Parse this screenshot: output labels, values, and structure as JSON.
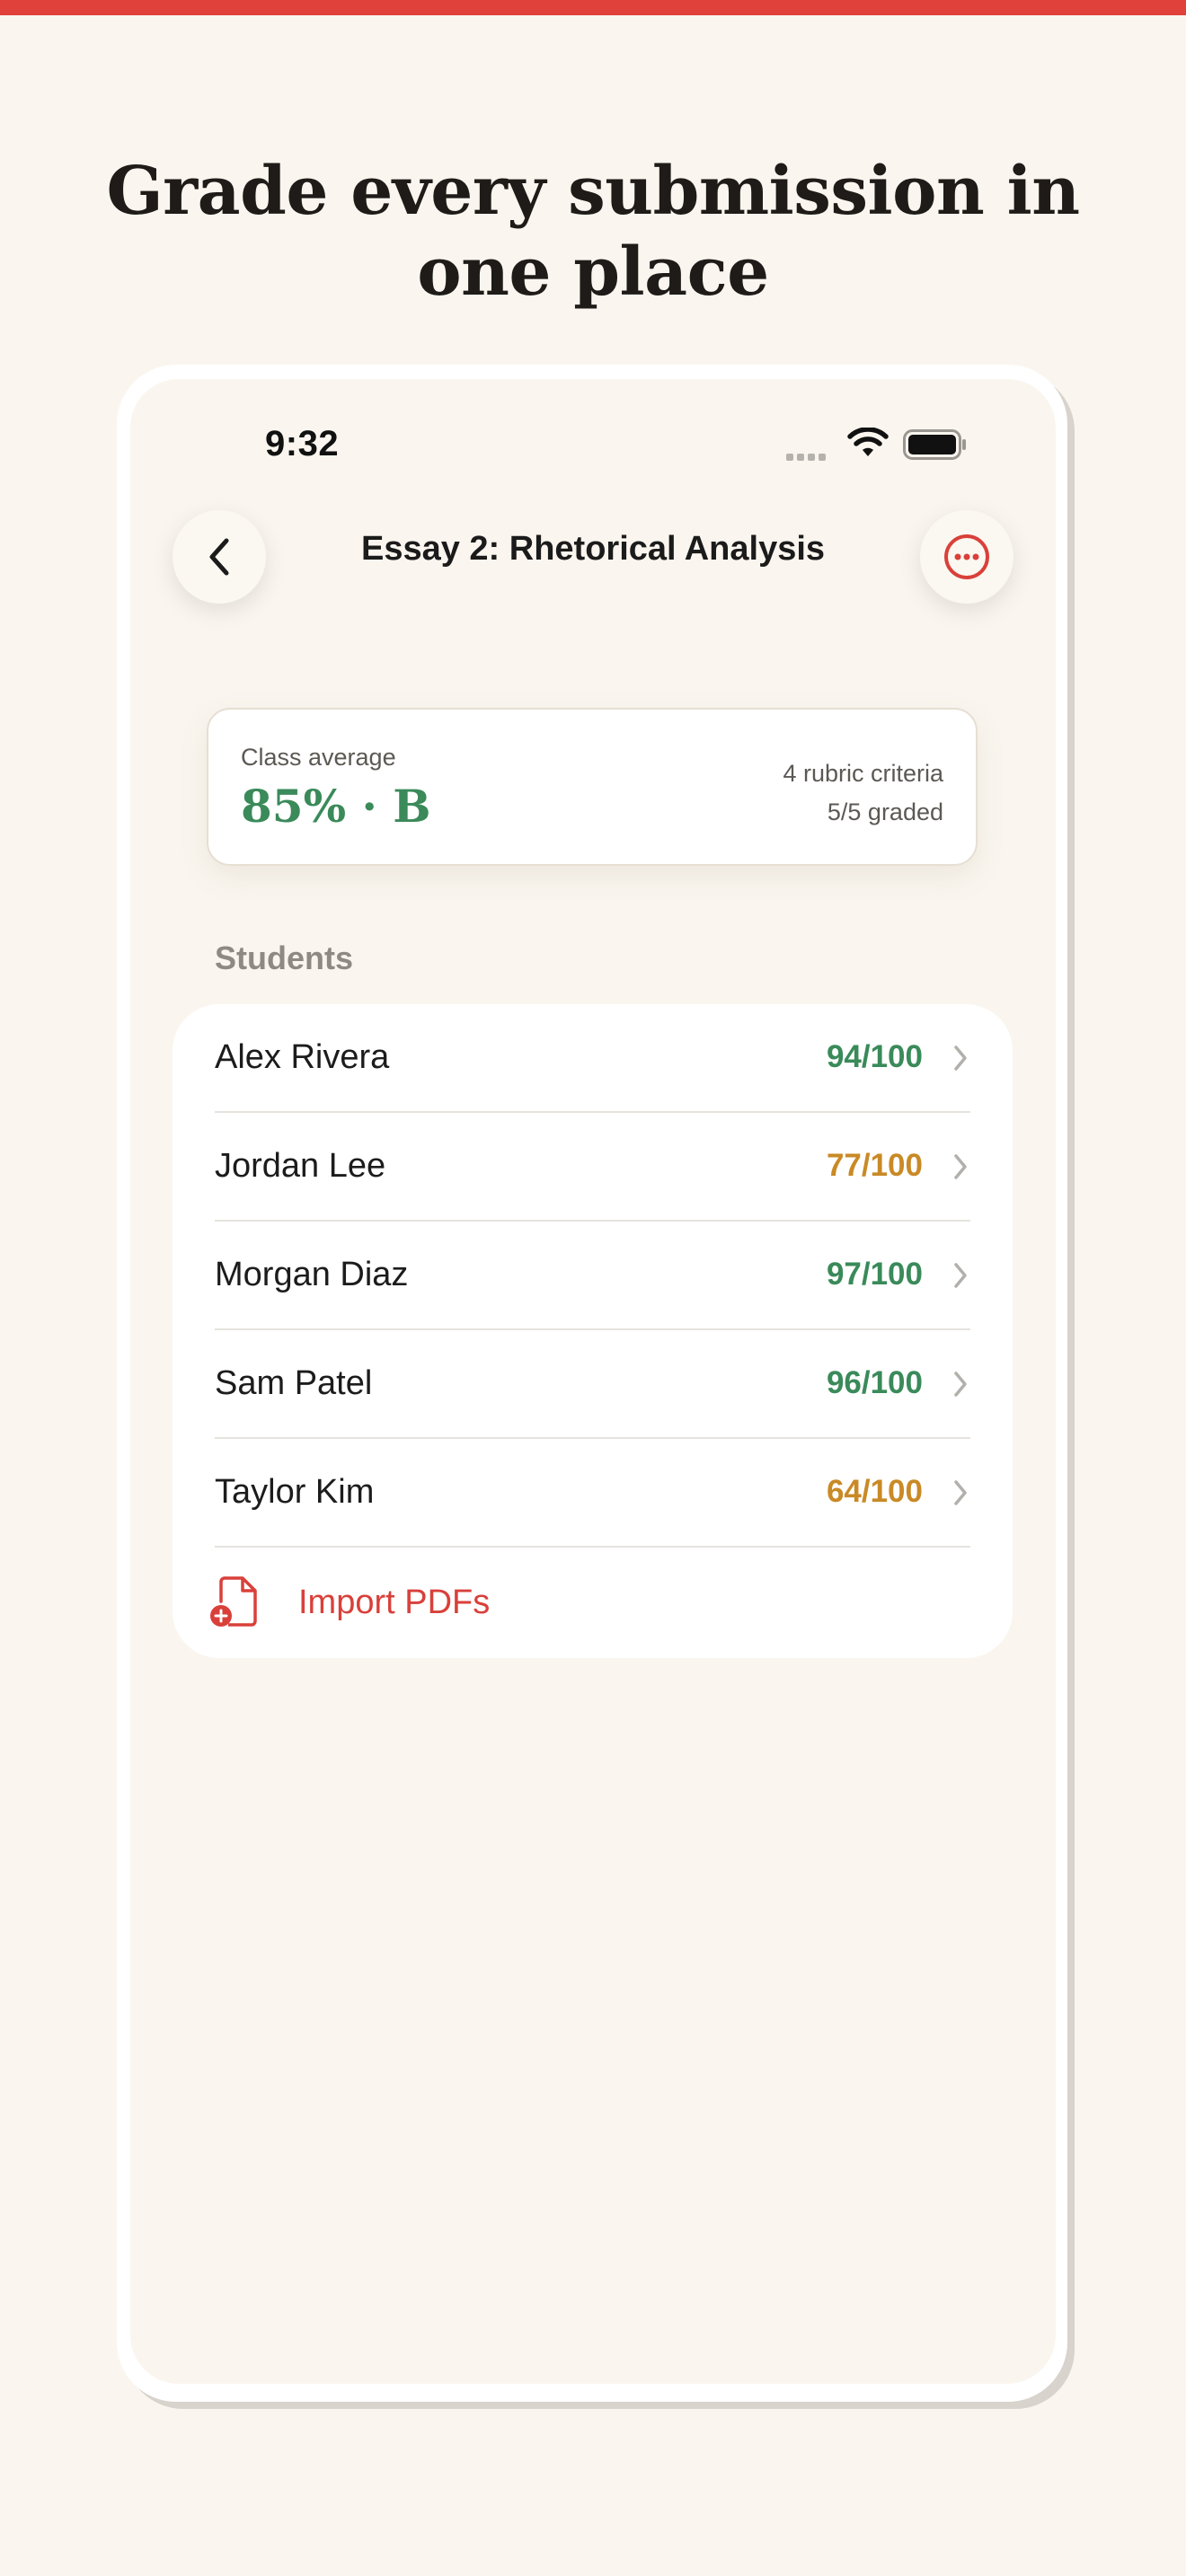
{
  "headline": "Grade every submission in one place",
  "status_bar": {
    "time": "9:32"
  },
  "nav": {
    "title": "Essay 2: Rhetorical Analysis"
  },
  "summary": {
    "label": "Class average",
    "value": "85% · B",
    "criteria": "4 rubric criteria",
    "graded": "5/5 graded"
  },
  "students": {
    "section_label": "Students",
    "rows": [
      {
        "name": "Alex Rivera",
        "score": "94/100",
        "color": "#3a8a5a"
      },
      {
        "name": "Jordan Lee",
        "score": "77/100",
        "color": "#c98a26"
      },
      {
        "name": "Morgan Diaz",
        "score": "97/100",
        "color": "#3a8a5a"
      },
      {
        "name": "Sam Patel",
        "score": "96/100",
        "color": "#3a8a5a"
      },
      {
        "name": "Taylor Kim",
        "score": "64/100",
        "color": "#c98a26"
      }
    ],
    "import_label": "Import PDFs"
  },
  "colors": {
    "accent": "#e0413b",
    "pass": "#3a8a5a",
    "warn": "#c98a26",
    "background": "#faf6ef"
  }
}
